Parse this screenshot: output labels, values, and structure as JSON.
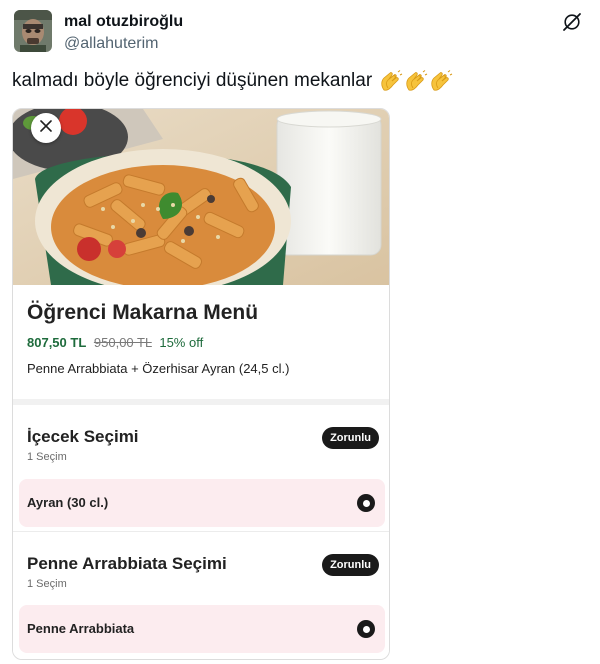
{
  "tweet": {
    "display_name": "mal otuzbiroğlu",
    "handle": "@allahuterim",
    "text": "kalmadı böyle öğrenciyi düşünen mekanlar",
    "emoji": [
      "clapping-hands",
      "clapping-hands",
      "clapping-hands"
    ],
    "logo_icon": "x-logo-icon"
  },
  "card": {
    "close_icon": "close-icon",
    "menu": {
      "title": "Öğrenci Makarna Menü",
      "price": "807,50 TL",
      "old_price": "950,00 TL",
      "discount": "15% off",
      "description": "Penne Arrabbiata + Özerhisar Ayran (24,5 cl.)"
    },
    "sections": [
      {
        "title": "İçecek Seçimi",
        "subtitle": "1 Seçim",
        "badge": "Zorunlu",
        "option": "Ayran (30 cl.)",
        "selected": true
      },
      {
        "title": "Penne Arrabbiata Seçimi",
        "subtitle": "1 Seçim",
        "badge": "Zorunlu",
        "option": "Penne Arrabbiata",
        "selected": true
      }
    ]
  },
  "colors": {
    "price_green": "#1e6b3c",
    "option_bg": "#fcecef",
    "badge_bg": "#1a1a1a",
    "handle_gray": "#536471"
  }
}
